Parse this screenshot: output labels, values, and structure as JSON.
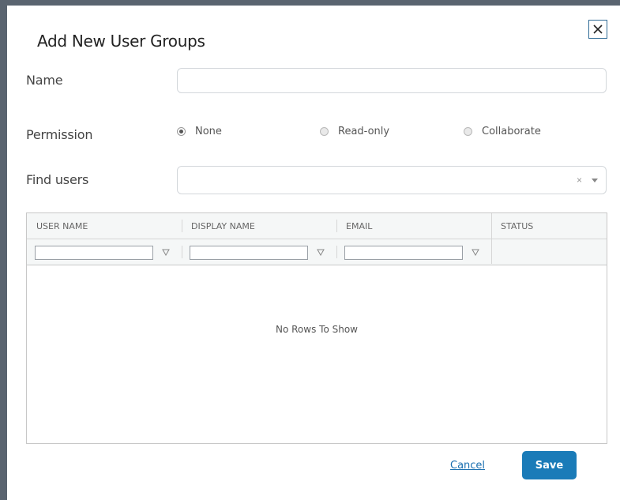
{
  "dialog": {
    "title": "Add New User Groups",
    "close_icon": "close-icon"
  },
  "form": {
    "name_label": "Name",
    "name_value": "",
    "permission_label": "Permission",
    "permission_options": [
      {
        "label": "None",
        "checked": true
      },
      {
        "label": "Read-only",
        "checked": false
      },
      {
        "label": "Collaborate",
        "checked": false
      }
    ],
    "find_users_label": "Find users",
    "find_users_value": "",
    "clear_symbol": "×"
  },
  "grid": {
    "columns": [
      "USER NAME",
      "DISPLAY NAME",
      "EMAIL",
      "STATUS"
    ],
    "filter_icon": "filter-icon",
    "empty_message": "No Rows To Show"
  },
  "actions": {
    "cancel_label": "Cancel",
    "save_label": "Save"
  },
  "colors": {
    "accent": "#1a7bb8",
    "link": "#1a6fb0",
    "backdrop": "#5a6470"
  }
}
